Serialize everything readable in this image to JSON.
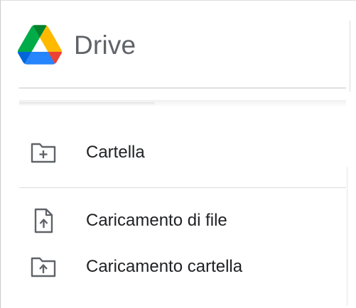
{
  "header": {
    "product_name": "Drive",
    "logo_icon": "google-drive-logo",
    "logo_colors": {
      "green": "#0F9D58",
      "blue": "#4285F4",
      "yellow": "#FBBC04",
      "red": "#EA4335",
      "dark_blue": "#1967D2"
    }
  },
  "menu": {
    "items": [
      {
        "label": "Cartella",
        "icon": "new-folder-icon"
      },
      {
        "label": "Caricamento di file",
        "icon": "file-upload-icon"
      },
      {
        "label": "Caricamento cartella",
        "icon": "folder-upload-icon"
      }
    ]
  },
  "colors": {
    "text": "#202124",
    "product_text": "#5f6368",
    "icon": "#5f6368",
    "divider": "#dadce0"
  }
}
